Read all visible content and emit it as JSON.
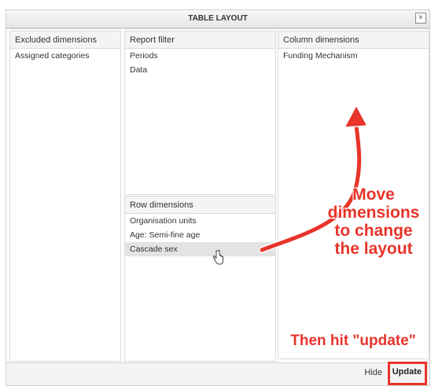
{
  "dialog": {
    "title": "TABLE LAYOUT",
    "close_label": "×"
  },
  "panels": {
    "excluded": {
      "header": "Excluded dimensions",
      "items": [
        "Assigned categories"
      ]
    },
    "filter": {
      "header": "Report filter",
      "items": [
        "Periods",
        "Data"
      ]
    },
    "column": {
      "header": "Column dimensions",
      "items": [
        "Funding Mechanism"
      ]
    },
    "row": {
      "header": "Row dimensions",
      "items": [
        "Organisation units",
        "Age: Semi-fine age",
        "Cascade sex"
      ],
      "selected_index": 2
    }
  },
  "footer": {
    "hide_label": "Hide",
    "update_label": "Update"
  },
  "annotations": {
    "move_lines": [
      "Move",
      "dimensions",
      "to change",
      "the layout"
    ],
    "update_note": "Then hit \"update\""
  },
  "colors": {
    "annotation_red": "#e8342a",
    "selected_row": "#e3e3e3"
  },
  "icons": {
    "close": "close-icon",
    "cursor": "hand-pointer-icon",
    "arrow": "curved-arrow-icon"
  }
}
